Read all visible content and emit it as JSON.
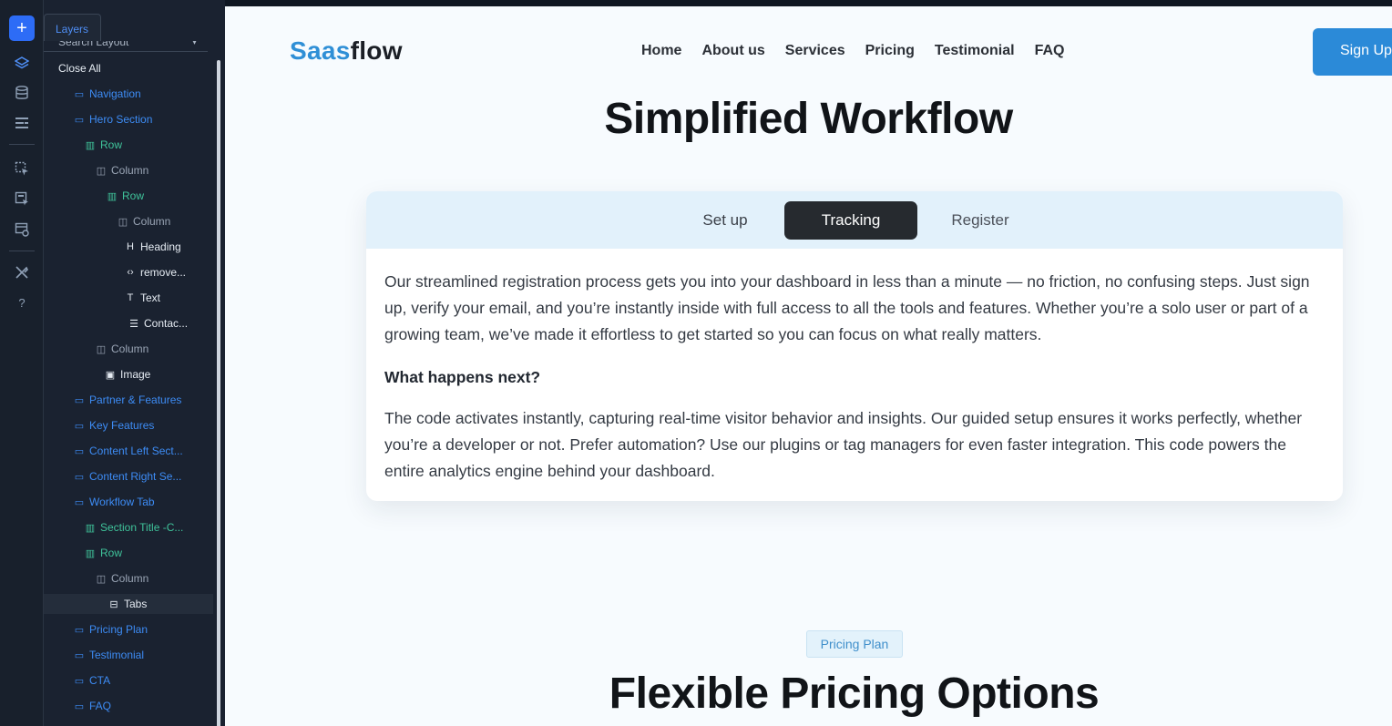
{
  "rail": {
    "icons": [
      "add-icon",
      "layers-icon",
      "database-icon",
      "list-icon",
      "page-select-icon",
      "component-icon",
      "settings-panel-icon",
      "tools-icon",
      "help-icon"
    ],
    "add_glyph": "+",
    "help_glyph": "?"
  },
  "panel": {
    "tab_label": "Layers",
    "search_label": "Search Layout",
    "close_all": "Close All",
    "tree": [
      {
        "label": "Navigation",
        "kind": "section"
      },
      {
        "label": "Hero Section",
        "kind": "section"
      },
      {
        "label": "Row",
        "kind": "row"
      },
      {
        "label": "Column",
        "kind": "column"
      },
      {
        "label": "Row",
        "kind": "row"
      },
      {
        "label": "Column",
        "kind": "column"
      },
      {
        "label": "Heading",
        "kind": "heading"
      },
      {
        "label": "remove...",
        "kind": "code"
      },
      {
        "label": "Text",
        "kind": "text"
      },
      {
        "label": "Contac...",
        "kind": "form"
      },
      {
        "label": "Column",
        "kind": "column"
      },
      {
        "label": "Image",
        "kind": "image"
      },
      {
        "label": "Partner & Features",
        "kind": "section"
      },
      {
        "label": "Key Features",
        "kind": "section"
      },
      {
        "label": "Content Left Sect...",
        "kind": "section"
      },
      {
        "label": "Content Right Se...",
        "kind": "section"
      },
      {
        "label": "Workflow Tab",
        "kind": "section"
      },
      {
        "label": "Section Title -C...",
        "kind": "row"
      },
      {
        "label": "Row",
        "kind": "row"
      },
      {
        "label": "Column",
        "kind": "column"
      },
      {
        "label": "Tabs",
        "kind": "tabs"
      },
      {
        "label": "Pricing Plan",
        "kind": "section"
      },
      {
        "label": "Testimonial",
        "kind": "section"
      },
      {
        "label": "CTA",
        "kind": "section"
      },
      {
        "label": "FAQ",
        "kind": "section"
      }
    ]
  },
  "site": {
    "logo_a": "Saas",
    "logo_b": "flow",
    "nav": [
      "Home",
      "About us",
      "Services",
      "Pricing",
      "Testimonial",
      "FAQ"
    ],
    "signup": "Sign Up",
    "workflow_title": "Simplified Workflow",
    "tabs": [
      "Set up",
      "Tracking",
      "Register"
    ],
    "active_tab": "Tracking",
    "para1": "Our streamlined registration process gets you into your dashboard in less than a minute — no friction, no confusing steps. Just sign up, verify your email, and you’re instantly inside with full access to all the tools and features. Whether you’re a solo user or part of a growing team, we’ve made it effortless to get started so you can focus on what really matters.",
    "question": "What happens next?",
    "para2": "The code activates instantly, capturing real-time visitor behavior and insights. Our guided setup ensures it works perfectly, whether you’re a developer or not. Prefer automation? Use our plugins or tag managers for even faster integration. This code powers the entire analytics engine behind your dashboard.",
    "pricing_pill": "Pricing Plan",
    "pricing_title": "Flexible Pricing Options"
  },
  "colors": {
    "accent": "#2b8ad8",
    "tab_active_bg": "#262a2f",
    "tree_section": "#3d8cf5",
    "tree_row": "#3fc39a"
  }
}
